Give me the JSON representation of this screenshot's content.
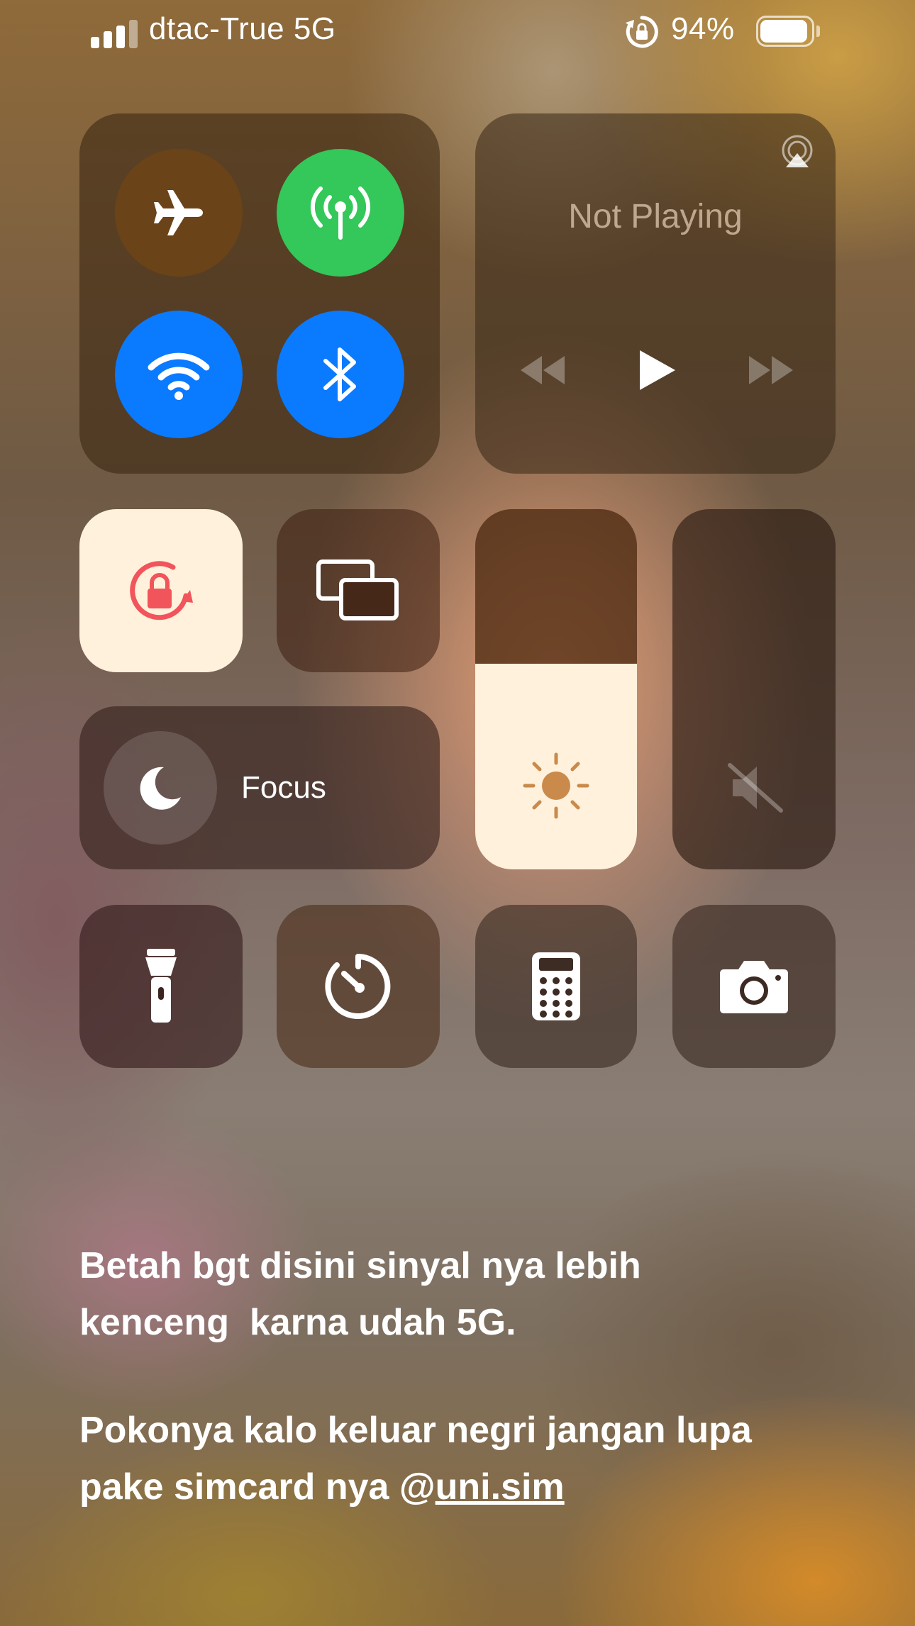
{
  "status_bar": {
    "carrier": "dtac-True 5G",
    "battery_percent": "94%",
    "battery_level": 0.94
  },
  "media": {
    "status": "Not Playing"
  },
  "focus": {
    "label": "Focus"
  },
  "brightness": {
    "level": 0.57
  },
  "volume": {
    "level": 0,
    "muted": true
  },
  "toggles": {
    "airplane_mode": false,
    "cellular_data": true,
    "wifi": true,
    "bluetooth": true,
    "orientation_lock": true
  },
  "colors": {
    "green": "#34c759",
    "blue": "#0a7aff",
    "orientation_red": "#f2545b",
    "airplane_bg": "#6b4318",
    "light_tile": "#fff1dc"
  },
  "icons": {
    "airplane": "airplane-icon",
    "cellular": "antenna-icon",
    "wifi": "wifi-icon",
    "bluetooth": "bluetooth-icon",
    "airplay": "airplay-icon",
    "orientation_lock": "lock-rotation-icon",
    "screen_mirroring": "screen-mirroring-icon",
    "focus": "moon-icon",
    "brightness": "sun-icon",
    "volume": "speaker-muted-icon",
    "flashlight": "flashlight-icon",
    "timer": "timer-icon",
    "calculator": "calculator-icon",
    "camera": "camera-icon"
  },
  "caption": {
    "line1": "Betah bgt disini sinyal nya lebih",
    "line2": "kenceng  karna udah 5G.",
    "line3": "Pokonya kalo keluar negri jangan lupa",
    "line4_prefix": "pake simcard nya @",
    "line4_mention": "uni.sim"
  }
}
